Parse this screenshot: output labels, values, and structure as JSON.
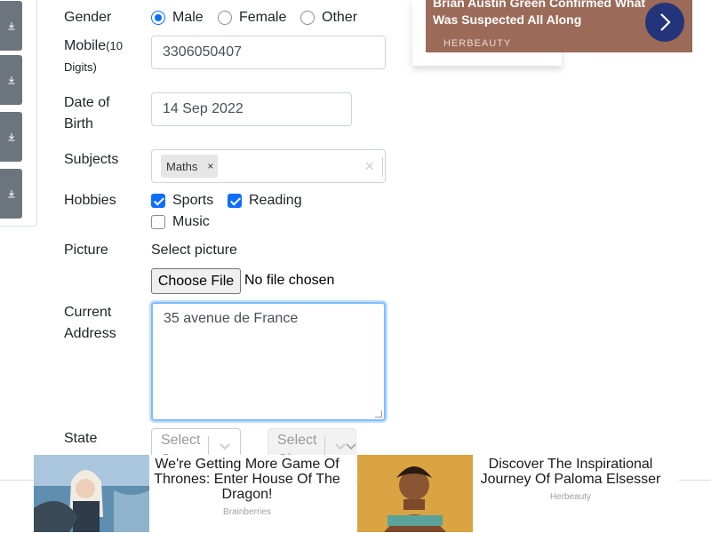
{
  "form": {
    "gender_label": "Gender",
    "gender_options": [
      "Male",
      "Female",
      "Other"
    ],
    "gender_selected": "Male",
    "mobile_label": "Mobile",
    "mobile_hint": "(10 Digits)",
    "mobile_value": "3306050407",
    "dob_label_line1": "Date of",
    "dob_label_line2": "Birth",
    "dob_value": "14 Sep 2022",
    "subjects_label": "Subjects",
    "subjects_selected": [
      "Maths"
    ],
    "subject_remove": "×",
    "subject_clear": "×",
    "hobbies_label": "Hobbies",
    "hobbies": [
      {
        "label": "Sports",
        "checked": true
      },
      {
        "label": "Reading",
        "checked": true
      },
      {
        "label": "Music",
        "checked": false
      }
    ],
    "picture_label": "Picture",
    "picture_prompt": "Select picture",
    "choose_file_button": "Choose File",
    "file_status": "No file chosen",
    "address_label_line1": "Current",
    "address_label_line2": "Address",
    "address_value": "35 avenue de France",
    "state_label": "State",
    "state_placeholder": "Select State",
    "city_placeholder": "Select City"
  },
  "sidebar": {
    "icons": [
      "download-icon",
      "download-icon",
      "download-icon",
      "download-icon"
    ]
  },
  "top_ad": {
    "headline": "Brian Austin Green Confirmed What Was Suspected All Along",
    "brand": "HERBEAUTY",
    "button_icon": "chevron-right-icon"
  },
  "bottom_ads": [
    {
      "title": "We're Getting More Game Of Thrones: Enter House Of The Dragon!",
      "source": "Brainberries"
    },
    {
      "title": "Discover The Inspirational Journey Of Paloma Elsesser",
      "source": "Herbeauty"
    }
  ],
  "colors": {
    "accent": "#0d6efd",
    "sidebar_button": "#6c757d",
    "ad_button": "#23357a"
  }
}
